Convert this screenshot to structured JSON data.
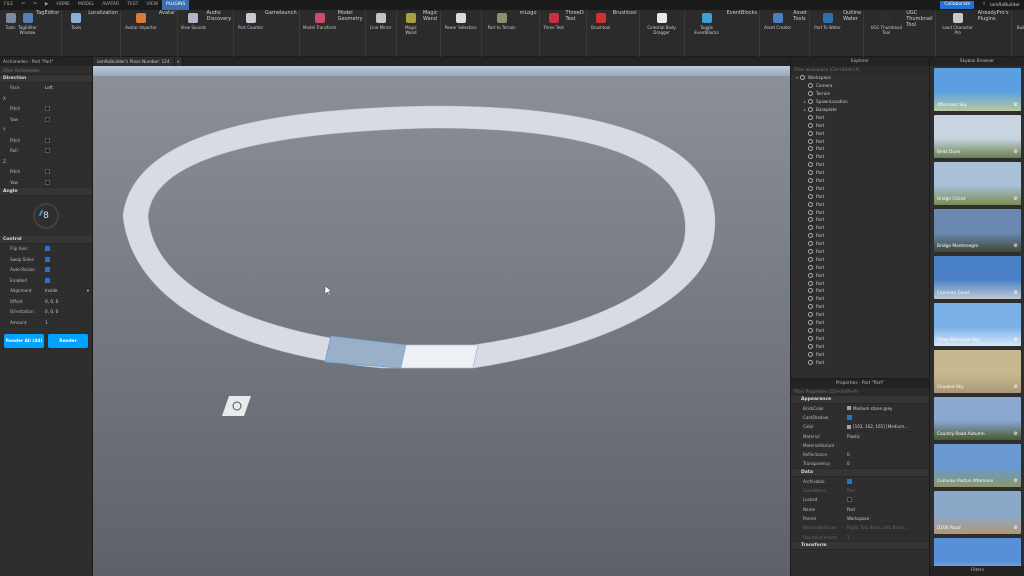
{
  "menu": {
    "file": "FILE",
    "tabs": [
      "HOME",
      "MODEL",
      "AVATAR",
      "TEST",
      "VIEW",
      "PLUGINS"
    ],
    "active": "PLUGINS",
    "collaborate": "Collaborate",
    "user": "iamRoBuilder"
  },
  "ribbon": [
    {
      "group": "TagEditor",
      "buttons": [
        {
          "label": "Tools",
          "color": "#7a8aa0"
        },
        {
          "label": "TagEditor Window",
          "color": "#5a7fb8"
        }
      ]
    },
    {
      "group": "Localization",
      "buttons": [
        {
          "label": "Tools",
          "color": "#8ab0d8"
        }
      ]
    },
    {
      "group": "Avatar",
      "buttons": [
        {
          "label": "Avatar Importer",
          "color": "#d97a3a"
        }
      ]
    },
    {
      "group": "Audio Discovery",
      "buttons": [
        {
          "label": "View Sounds",
          "color": "#b0b8c8"
        }
      ]
    },
    {
      "group": "Gamelaunch",
      "buttons": [
        {
          "label": "Part Counter",
          "color": "#c8ccd2"
        }
      ]
    },
    {
      "group": "Model Geometry",
      "buttons": [
        {
          "label": "Model Transform",
          "color": "#d04a6a"
        }
      ]
    },
    {
      "group": "",
      "buttons": [
        {
          "label": "Line Mirror",
          "color": "#c0c4ca"
        }
      ]
    },
    {
      "group": "Magic Wand",
      "buttons": [
        {
          "label": "Magic Wand",
          "color": "#a8a040"
        }
      ]
    },
    {
      "group": "",
      "buttons": [
        {
          "label": "Power Selectors",
          "color": "#d8dce0"
        }
      ]
    },
    {
      "group": "mLogo",
      "buttons": [
        {
          "label": "Part to Terrain",
          "color": "#8a9070"
        }
      ]
    },
    {
      "group": "ThreeD Text",
      "buttons": [
        {
          "label": "Three Text",
          "color": "#c83040"
        }
      ]
    },
    {
      "group": "Brushtool",
      "buttons": [
        {
          "label": "Brushtool",
          "color": "#d03030"
        }
      ]
    },
    {
      "group": "",
      "buttons": [
        {
          "label": "Celestial Body Dragger",
          "color": "#e8e8e8"
        }
      ]
    },
    {
      "group": "EventBlocks",
      "buttons": [
        {
          "label": "Toggle EventBlocks",
          "color": "#3aa0d8"
        }
      ]
    },
    {
      "group": "Asset Tools",
      "buttons": [
        {
          "label": "Asset Creator",
          "color": "#4a80c0"
        }
      ]
    },
    {
      "group": "Outline Water",
      "buttons": [
        {
          "label": "Part To Water",
          "color": "#2a70b0"
        }
      ]
    },
    {
      "group": "UGC Thumbnail Tool",
      "buttons": [
        {
          "label": "UGC Thumbnail Tool",
          "color": "#2e2e2e"
        }
      ]
    },
    {
      "group": "AlreadyPro's Plugins",
      "buttons": [
        {
          "label": "Load Character Pro",
          "color": "#c8c8c8"
        }
      ]
    },
    {
      "group": "Building Tools by F3X",
      "buttons": [
        {
          "label": "Building Tools by F3X",
          "color": "#e0a030"
        }
      ]
    },
    {
      "group": "Archimedes",
      "buttons": [
        {
          "label": "Launch Archimedes",
          "color": "#4a8ad0"
        }
      ]
    },
    {
      "group": "",
      "buttons": [
        {
          "label": "Model Resize",
          "color": "#9a6060"
        }
      ]
    },
    {
      "group": "Waterfall Generator",
      "buttons": [
        {
          "label": "Generate Waterfall",
          "color": "#40a0d0"
        }
      ]
    },
    {
      "group": "ColorTools",
      "buttons": [
        {
          "label": "Hue and Saturation",
          "color": "#d05090"
        }
      ]
    },
    {
      "group": "",
      "buttons": [
        {
          "label": "GeomTools",
          "color": "#c03030"
        }
      ]
    },
    {
      "group": "",
      "buttons": [
        {
          "label": "PluginsBy Robot(@Roboxcaffeo,P)",
          "color": "#2e2e2e"
        }
      ]
    },
    {
      "group": "",
      "buttons": [
        {
          "label": "Lighting Settings",
          "color": "#d0a030"
        }
      ]
    },
    {
      "group": "Skybox",
      "buttons": [
        {
          "label": "Skyboxes",
          "color": "#4a90c8"
        }
      ]
    },
    {
      "group": "",
      "buttons": [
        {
          "label": "Beveler",
          "color": "#b8bcc4"
        }
      ]
    },
    {
      "group": "Autod()",
      "buttons": [
        {
          "label": "AutoCode",
          "color": "#e0c030"
        }
      ]
    }
  ],
  "doc_tab": "iamRoBuilder's Place Number: 124",
  "archimedes": {
    "title": "Archimedes - Part \"Part\"",
    "filter_placeholder": "Filter Archimedes",
    "direction_title": "Direction",
    "face_label": "Face",
    "face_value": "Left",
    "axes": [
      {
        "name": "X",
        "rows": [
          {
            "label": "Pitch",
            "on": false
          },
          {
            "label": "Yaw",
            "on": false
          }
        ]
      },
      {
        "name": "Y",
        "rows": [
          {
            "label": "Pitch",
            "on": false
          },
          {
            "label": "Roll",
            "on": false
          }
        ]
      },
      {
        "name": "Z",
        "rows": [
          {
            "label": "Pitch",
            "on": false
          },
          {
            "label": "Yaw",
            "on": false
          }
        ]
      }
    ],
    "angle_title": "Angle",
    "angle_value": "8",
    "control_title": "Control",
    "control": [
      {
        "label": "Flip Axis",
        "on": true
      },
      {
        "label": "Swap Sides",
        "on": true
      },
      {
        "label": "Auto-Resize",
        "on": true
      },
      {
        "label": "Enabled",
        "on": true
      }
    ],
    "alignment_label": "Alignment",
    "alignment_value": "Inside",
    "offset_label": "Offset",
    "offset_value": "0, 0, 0",
    "orientation_label": "Orientation",
    "orientation_value": "0, 0, 0",
    "amount_label": "Amount",
    "amount_value": "1",
    "render_all": "Render All (44)",
    "render": "Render"
  },
  "explorer": {
    "title": "Explorer",
    "filter": "Filter workspace (Ctrl+Shift+X)",
    "items": [
      {
        "name": "Workspace",
        "depth": 0,
        "arrow": "▾"
      },
      {
        "name": "Camera",
        "depth": 1,
        "arrow": ""
      },
      {
        "name": "Terrain",
        "depth": 1,
        "arrow": ""
      },
      {
        "name": "SpawnLocation",
        "depth": 1,
        "arrow": "▸"
      },
      {
        "name": "Baseplate",
        "depth": 1,
        "arrow": "▸"
      }
    ],
    "part_label": "Part",
    "part_count": 32
  },
  "properties": {
    "title": "Properties - Part \"Part\"",
    "filter": "Filter Properties (Ctrl+Shift+P)",
    "appearance_title": "Appearance",
    "appearance": [
      {
        "k": "BrickColor",
        "v": "Medium stone grey",
        "swatch": "#a3a2a5"
      },
      {
        "k": "CastShadow",
        "v": "",
        "check": true
      },
      {
        "k": "Color",
        "v": "[163, 162, 165] [Medium...",
        "swatch": "#a3a2a5"
      },
      {
        "k": "Material",
        "v": "Plastic"
      },
      {
        "k": "MaterialVariant",
        "v": ""
      },
      {
        "k": "Reflectance",
        "v": "0"
      },
      {
        "k": "Transparency",
        "v": "0"
      }
    ],
    "data_title": "Data",
    "data": [
      {
        "k": "Archivable",
        "v": "",
        "check": true
      },
      {
        "k": "ClassName",
        "v": "Part",
        "dim": true
      },
      {
        "k": "Locked",
        "v": "",
        "check": false
      },
      {
        "k": "Name",
        "v": "Part"
      },
      {
        "k": "Parent",
        "v": "Workspace"
      },
      {
        "k": "ResizeableFaces",
        "v": "Right, Top, Back, Left, Botto...",
        "dim": true
      },
      {
        "k": "ResizeIncrement",
        "v": "1",
        "dim": true
      }
    ],
    "transform_title": "Transform"
  },
  "skybox": {
    "title": "Skybox Browser",
    "items": [
      {
        "name": "Afternoon Sky",
        "c1": "#5aa0e0",
        "c2": "#b8c8a0"
      },
      {
        "name": "Bella Dune",
        "c1": "#c8d4e0",
        "c2": "#6a8050"
      },
      {
        "name": "Bridge Chiloé",
        "c1": "#a8c0d8",
        "c2": "#7a8a50"
      },
      {
        "name": "Bridge Montenegro",
        "c1": "#6a88b0",
        "c2": "#404838"
      },
      {
        "name": "Canarian Coast",
        "c1": "#4a80c8",
        "c2": "#c0c8d0"
      },
      {
        "name": "Clear Afternoon Sky",
        "c1": "#7ab0e8",
        "c2": "#d8e8f8"
      },
      {
        "name": "Clouded Sky",
        "c1": "#c8b890",
        "c2": "#a89878"
      },
      {
        "name": "Country Road Autumn",
        "c1": "#8aa8d0",
        "c2": "#4a5830"
      },
      {
        "name": "Cumulus Pastus Afternoon",
        "c1": "#6a98d0",
        "c2": "#8a9868"
      },
      {
        "name": "D106 Road",
        "c1": "#8aa8c8",
        "c2": "#b09878"
      },
      {
        "name": "",
        "c1": "#5890d8",
        "c2": "#c8dcf0"
      }
    ],
    "filters": "Filters"
  }
}
